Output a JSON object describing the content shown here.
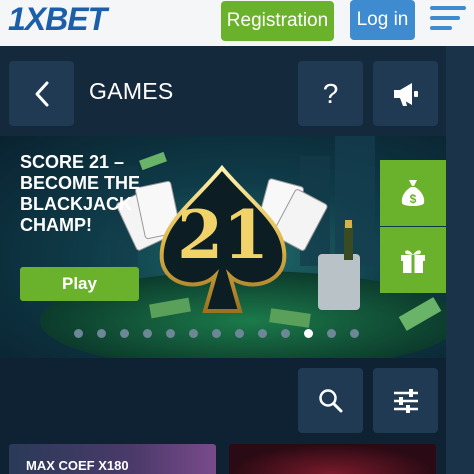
{
  "header": {
    "logo": "1XBET",
    "registration_label": "Registration",
    "login_label": "Log in"
  },
  "section": {
    "title": "GAMES",
    "help_label": "?"
  },
  "banner": {
    "promo_lines": [
      "SCORE 21 –",
      "BECOME THE",
      "BLACKJACK",
      "CHAMP!"
    ],
    "play_label": "Play",
    "center_number": "21",
    "slide_count": 13,
    "active_slide": 10
  },
  "games": [
    {
      "label": "MAX COEF X180"
    },
    {
      "label": ""
    }
  ],
  "colors": {
    "brand_blue": "#1a5fa8",
    "accent_green": "#6bb22c",
    "login_blue": "#3e8bd0",
    "dark_bg": "#0e2234"
  }
}
